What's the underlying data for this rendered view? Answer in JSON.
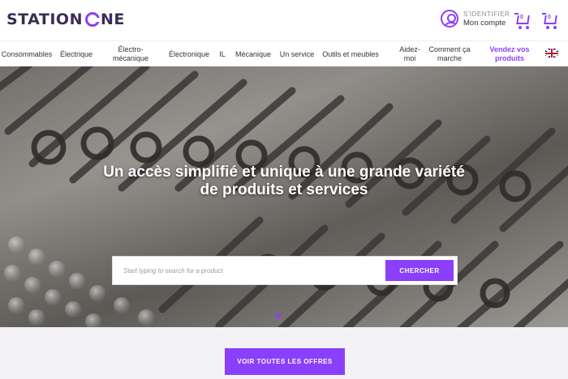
{
  "header": {
    "logo_text_1": "STATION",
    "logo_text_2": "NE",
    "account_small": "S'IDENTIFIER",
    "account_big": "Mon compte",
    "cart_count_1": "0",
    "cart_count_2": "0"
  },
  "nav": {
    "items": [
      {
        "label": "Consommables"
      },
      {
        "label": "Électrique"
      },
      {
        "label": "Électro-mécanique"
      },
      {
        "label": "Électronique"
      },
      {
        "label": "IL"
      },
      {
        "label": "Mécanique"
      },
      {
        "label": "Un service"
      },
      {
        "label": "Outils et meubles"
      },
      {
        "label": "Aidez-moi"
      },
      {
        "label": "Comment ça marche"
      },
      {
        "label": "Vendez vos produits"
      }
    ]
  },
  "hero": {
    "title_line1": "Un accès simplifié et unique à une grande variété",
    "title_line2": "de produits et services",
    "search_placeholder": "Start typing to search for a product",
    "search_button": "CHERCHER"
  },
  "bottom": {
    "offers_button": "VOIR TOUTES LES OFFRES"
  },
  "colors": {
    "accent": "#8a3ffc"
  }
}
